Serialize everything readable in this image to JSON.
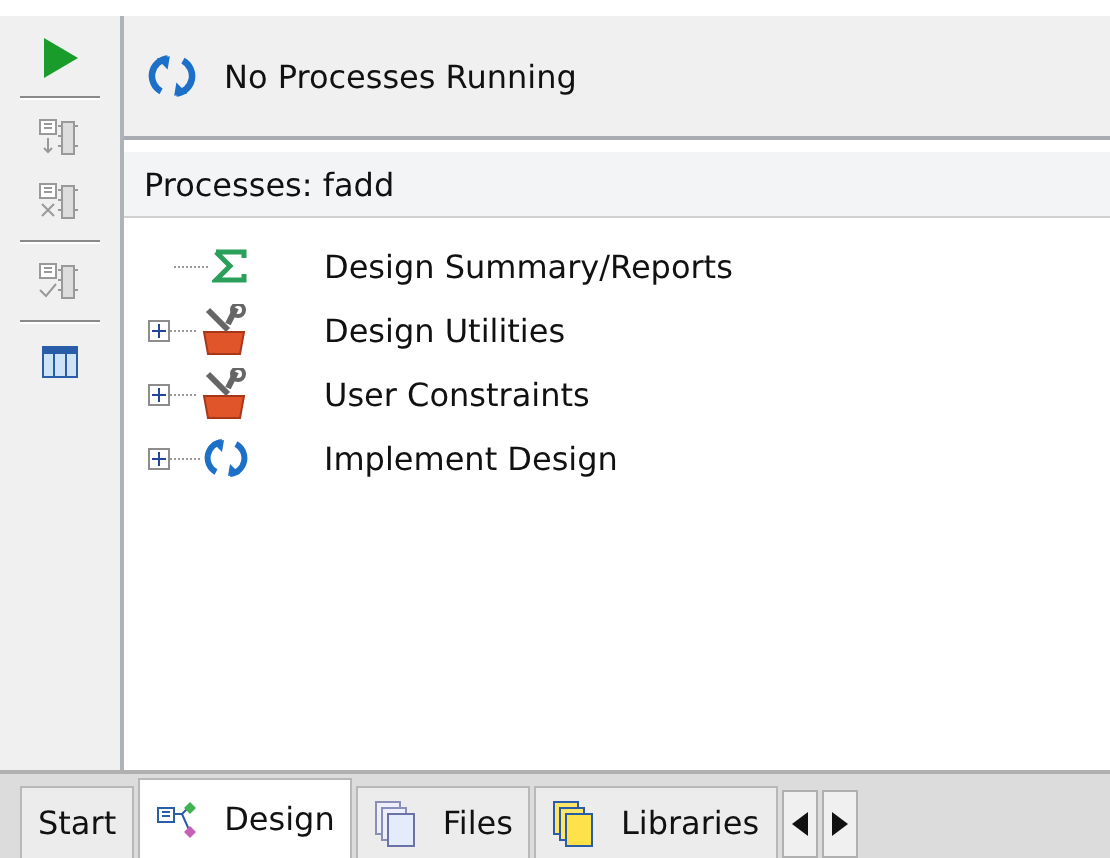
{
  "status": {
    "text": "No Processes Running"
  },
  "panel": {
    "title": "Processes: fadd"
  },
  "tree": [
    {
      "label": "Design Summary/Reports",
      "kind": "sigma"
    },
    {
      "label": "Design Utilities",
      "kind": "tools",
      "expanded": false
    },
    {
      "label": "User Constraints",
      "kind": "tools",
      "expanded": false
    },
    {
      "label": "Implement Design",
      "kind": "refresh",
      "expanded": false
    }
  ],
  "tabs": [
    {
      "label": "Start",
      "selected": false,
      "kind": "plain"
    },
    {
      "label": "Design",
      "selected": true,
      "kind": "design"
    },
    {
      "label": "Files",
      "selected": false,
      "kind": "files"
    },
    {
      "label": "Libraries",
      "selected": false,
      "kind": "libraries"
    }
  ]
}
